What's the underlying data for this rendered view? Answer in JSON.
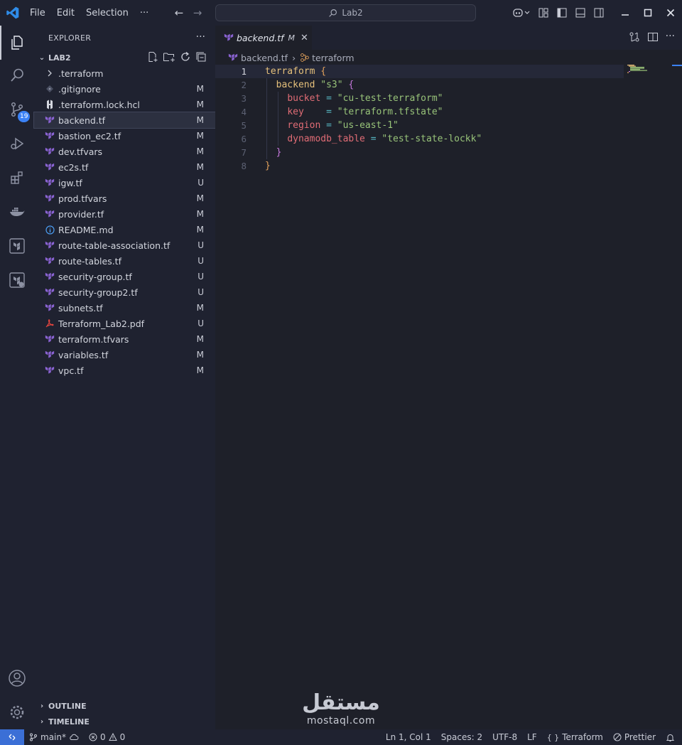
{
  "titlebar": {
    "menu": [
      "File",
      "Edit",
      "Selection",
      "···"
    ],
    "search_text": "Lab2"
  },
  "activity_bar": {
    "scm_badge": "19"
  },
  "sidebar": {
    "title": "EXPLORER",
    "folder_name": "LAB2",
    "files": [
      {
        "name": ".terraform",
        "status": "",
        "icon": "chevron-right-icon"
      },
      {
        "name": ".gitignore",
        "status": "M",
        "icon": "git-icon"
      },
      {
        "name": ".terraform.lock.hcl",
        "status": "M",
        "icon": "hcl-icon"
      },
      {
        "name": "backend.tf",
        "status": "M",
        "icon": "terraform-icon"
      },
      {
        "name": "bastion_ec2.tf",
        "status": "M",
        "icon": "terraform-icon"
      },
      {
        "name": "dev.tfvars",
        "status": "M",
        "icon": "terraform-icon"
      },
      {
        "name": "ec2s.tf",
        "status": "M",
        "icon": "terraform-icon"
      },
      {
        "name": "igw.tf",
        "status": "U",
        "icon": "terraform-icon"
      },
      {
        "name": "prod.tfvars",
        "status": "M",
        "icon": "terraform-icon"
      },
      {
        "name": "provider.tf",
        "status": "M",
        "icon": "terraform-icon"
      },
      {
        "name": "README.md",
        "status": "M",
        "icon": "info-icon"
      },
      {
        "name": "route-table-association.tf",
        "status": "U",
        "icon": "terraform-icon"
      },
      {
        "name": "route-tables.tf",
        "status": "U",
        "icon": "terraform-icon"
      },
      {
        "name": "security-group.tf",
        "status": "U",
        "icon": "terraform-icon"
      },
      {
        "name": "security-group2.tf",
        "status": "U",
        "icon": "terraform-icon"
      },
      {
        "name": "subnets.tf",
        "status": "M",
        "icon": "terraform-icon"
      },
      {
        "name": "Terraform_Lab2.pdf",
        "status": "U",
        "icon": "pdf-icon"
      },
      {
        "name": "terraform.tfvars",
        "status": "M",
        "icon": "terraform-icon"
      },
      {
        "name": "variables.tf",
        "status": "M",
        "icon": "terraform-icon"
      },
      {
        "name": "vpc.tf",
        "status": "M",
        "icon": "terraform-icon"
      }
    ],
    "selected_file": "backend.tf",
    "outline_label": "OUTLINE",
    "timeline_label": "TIMELINE"
  },
  "editor": {
    "tab": {
      "name": "backend.tf",
      "status": "M"
    },
    "breadcrumb": {
      "file": "backend.tf",
      "symbol": "terraform"
    },
    "line_numbers": [
      "1",
      "2",
      "3",
      "4",
      "5",
      "6",
      "7",
      "8"
    ],
    "code": {
      "l1_kw": "terraform",
      "l1_brace": "{",
      "l2_kw": "backend",
      "l2_str": "\"s3\"",
      "l2_brace": "{",
      "l3_attr": "bucket",
      "l3_op": "=",
      "l3_str": "\"cu-test-terraform\"",
      "l4_attr": "key",
      "l4_op": "=",
      "l4_str": "\"terraform.tfstate\"",
      "l5_attr": "region",
      "l5_op": "=",
      "l5_str": "\"us-east-1\"",
      "l6_attr": "dynamodb_table",
      "l6_op": "=",
      "l6_str": "\"test-state-lockk\"",
      "l7_brace": "}",
      "l8_brace": "}"
    }
  },
  "statusbar": {
    "branch": "main*",
    "errors": "0",
    "warnings": "0",
    "position": "Ln 1, Col 1",
    "spaces": "Spaces: 2",
    "encoding": "UTF-8",
    "eol": "LF",
    "language": "Terraform",
    "formatter": "Prettier"
  },
  "watermark": {
    "arabic": "مستقل",
    "latin": "mostaql.com"
  },
  "colors": {
    "accent": "#3b82f6",
    "terraform": "#7b42bc",
    "background": "#1e2029"
  }
}
